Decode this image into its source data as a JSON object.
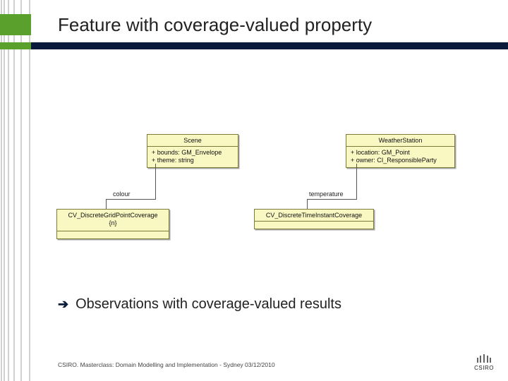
{
  "title": "Feature with coverage-valued property",
  "diagram": {
    "scene": {
      "name": "Scene",
      "attr1": "+   bounds:  GM_Envelope",
      "attr2": "+   theme:  string"
    },
    "weather": {
      "name": "WeatherStation",
      "attr1": "+   location:  GM_Point",
      "attr2": "+   owner:  CI_ResponsibleParty"
    },
    "colour_label": "colour",
    "grid": {
      "name": "CV_DiscreteGridPointCoverage",
      "sub": "{n}"
    },
    "temperature_label": "temperature",
    "time": {
      "name": "CV_DiscreteTimeInstantCoverage"
    }
  },
  "bullet": {
    "arrow": "➔",
    "text": "Observations with coverage-valued results"
  },
  "footer": "CSIRO.  Masterclass: Domain Modelling and Implementation -  Sydney 03/12/2010",
  "brand": "CSIRO"
}
